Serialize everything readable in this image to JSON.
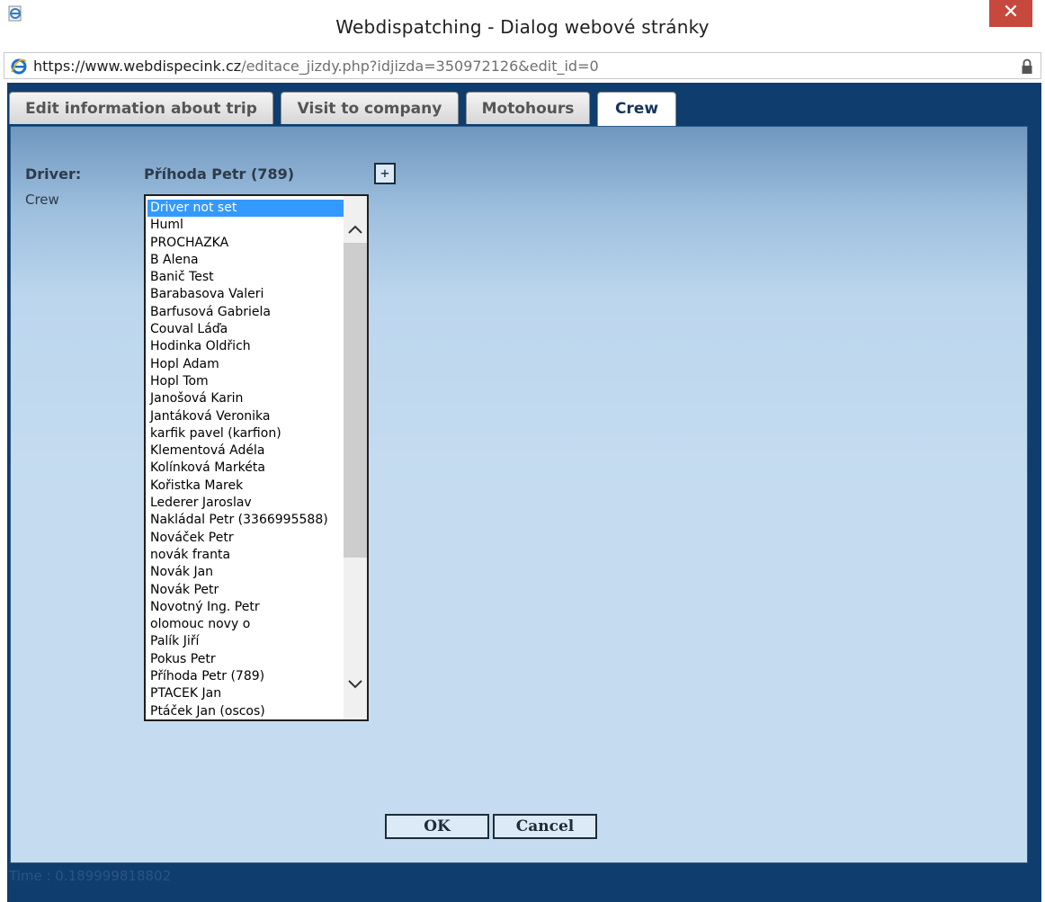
{
  "window": {
    "title": "Webdispatching - Dialog webové stránky",
    "close_glyph": "✕"
  },
  "address": {
    "proto": "https://www.",
    "domain": "webdispecink.cz",
    "path": "/editace_jizdy.php?idjizda=350972126&edit_id=0"
  },
  "tabs": [
    {
      "label": "Edit information about trip",
      "active": false
    },
    {
      "label": "Visit to company",
      "active": false
    },
    {
      "label": "Motohours",
      "active": false
    },
    {
      "label": "Crew",
      "active": true
    }
  ],
  "form": {
    "driver_label": "Driver:",
    "driver_value": "Příhoda Petr (789)",
    "add_button": "+",
    "crew_label": "Crew",
    "crew_options": [
      "Driver not set",
      "Huml",
      "PROCHAZKA",
      "B Alena",
      "Banič Test",
      "Barabasova Valeri",
      "Barfusová Gabriela",
      "Couval Láďa",
      "Hodinka Oldřich",
      "Hopl Adam",
      "Hopl Tom",
      "Janošová Karin",
      "Jantáková Veronika",
      "karfik pavel (karfion)",
      "Klementová Adéla",
      "Kolínková Markéta",
      "Kořistka Marek",
      "Lederer Jaroslav",
      "Nakládal Petr (3366995588)",
      "Nováček Petr",
      "novák franta",
      "Novák Jan",
      "Novák Petr",
      "Novotný Ing. Petr",
      "olomouc novy o",
      "Palík Jiří",
      "Pokus Petr",
      "Příhoda Petr (789)",
      "PTACEK Jan",
      "Ptáček Jan (oscos)"
    ],
    "selected_option": "Driver not set"
  },
  "buttons": {
    "ok": "OK",
    "cancel": "Cancel"
  },
  "footer": {
    "timing": "Time : 0.189999818802"
  },
  "colors": {
    "frame": "#0e3d6e",
    "close": "#c7483d",
    "selection": "#3399ff"
  },
  "icons": {
    "app": "ie-page-icon",
    "address": "ie-logo-icon",
    "lock": "lock-icon",
    "scroll_up": "chevron-up-icon",
    "scroll_down": "chevron-down-icon"
  }
}
